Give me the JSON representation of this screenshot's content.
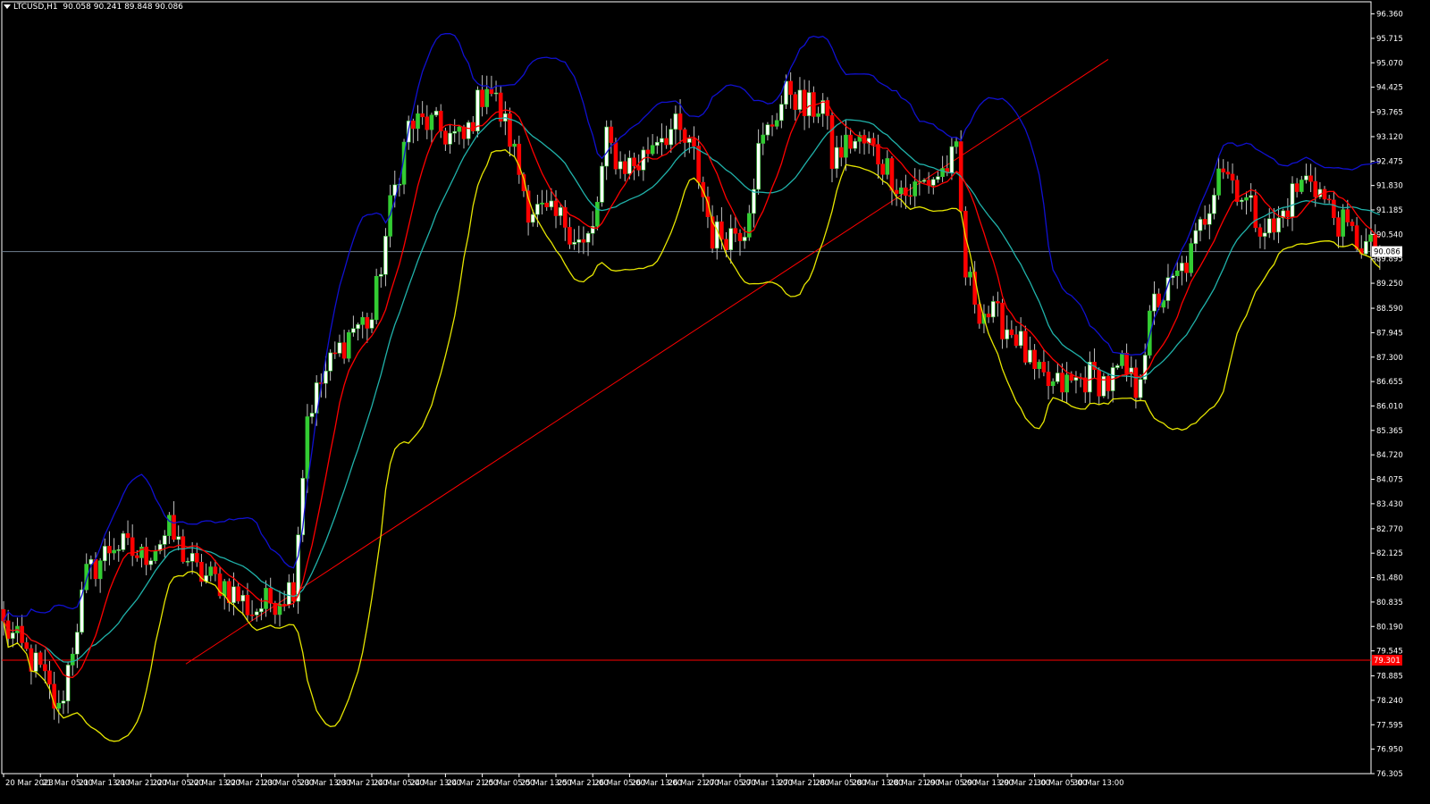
{
  "header": {
    "symbol": "LTCUSD,H1",
    "ohlc": "90.058 90.241 89.848 90.086"
  },
  "chart_data": {
    "type": "candlestick",
    "title": "LTCUSD,H1",
    "ylim": [
      76.305,
      96.68
    ],
    "y_ticks": [
      "96.360",
      "95.715",
      "95.070",
      "94.425",
      "93.765",
      "93.120",
      "92.475",
      "91.830",
      "91.185",
      "90.540",
      "89.895",
      "89.250",
      "88.590",
      "87.945",
      "87.300",
      "86.655",
      "86.010",
      "85.365",
      "84.720",
      "84.075",
      "83.430",
      "82.770",
      "82.125",
      "81.480",
      "80.835",
      "80.190",
      "79.545",
      "78.885",
      "78.240",
      "77.595",
      "76.950",
      "76.305"
    ],
    "x_ticks": [
      "20 Mar 2023",
      "21 Mar 05:00",
      "21 Mar 13:00",
      "21 Mar 21:00",
      "22 Mar 05:00",
      "22 Mar 13:00",
      "22 Mar 21:00",
      "23 Mar 05:00",
      "23 Mar 13:00",
      "23 Mar 21:00",
      "24 Mar 05:00",
      "24 Mar 13:00",
      "24 Mar 21:00",
      "25 Mar 05:00",
      "25 Mar 13:00",
      "25 Mar 21:00",
      "26 Mar 05:00",
      "26 Mar 13:00",
      "26 Mar 21:00",
      "27 Mar 05:00",
      "27 Mar 13:00",
      "27 Mar 21:00",
      "28 Mar 05:00",
      "28 Mar 13:00",
      "28 Mar 21:00",
      "29 Mar 05:00",
      "29 Mar 13:00",
      "29 Mar 21:00",
      "30 Mar 05:00",
      "30 Mar 13:00"
    ],
    "bars_per_tick": 8,
    "current_price": 90.086,
    "current_price_label": "90.086",
    "support_level": 79.3,
    "support_label": "79.301",
    "trendline": {
      "start": [
        "22 Mar 13:00",
        79.2
      ],
      "end": [
        "30 Mar 21:00",
        95.16
      ]
    },
    "close_anchors": [
      [
        0,
        80.2
      ],
      [
        8,
        79.0
      ],
      [
        12,
        77.9
      ],
      [
        18,
        81.5
      ],
      [
        24,
        82.4
      ],
      [
        30,
        82.0
      ],
      [
        36,
        82.7
      ],
      [
        42,
        81.6
      ],
      [
        48,
        81.3
      ],
      [
        54,
        80.6
      ],
      [
        60,
        81.0
      ],
      [
        63,
        81.3
      ],
      [
        66,
        85.8
      ],
      [
        70,
        86.9
      ],
      [
        76,
        88.1
      ],
      [
        80,
        88.3
      ],
      [
        84,
        91.2
      ],
      [
        88,
        93.4
      ],
      [
        92,
        93.5
      ],
      [
        96,
        93.2
      ],
      [
        100,
        93.0
      ],
      [
        105,
        94.6
      ],
      [
        110,
        93.1
      ],
      [
        114,
        91.3
      ],
      [
        118,
        91.0
      ],
      [
        122,
        90.9
      ],
      [
        126,
        90.2
      ],
      [
        128,
        90.6
      ],
      [
        131,
        93.0
      ],
      [
        134,
        92.4
      ],
      [
        138,
        92.4
      ],
      [
        142,
        93.2
      ],
      [
        146,
        93.3
      ],
      [
        150,
        92.6
      ],
      [
        154,
        90.5
      ],
      [
        158,
        90.6
      ],
      [
        161,
        90.8
      ],
      [
        164,
        92.7
      ],
      [
        168,
        93.8
      ],
      [
        171,
        94.4
      ],
      [
        174,
        93.8
      ],
      [
        178,
        94.0
      ],
      [
        180,
        92.5
      ],
      [
        184,
        93.0
      ],
      [
        188,
        92.9
      ],
      [
        192,
        92.3
      ],
      [
        196,
        91.6
      ],
      [
        200,
        91.9
      ],
      [
        204,
        92.2
      ],
      [
        207,
        92.6
      ],
      [
        209,
        89.5
      ],
      [
        212,
        88.6
      ],
      [
        216,
        88.3
      ],
      [
        220,
        87.9
      ],
      [
        224,
        86.8
      ],
      [
        228,
        86.5
      ],
      [
        232,
        86.6
      ],
      [
        236,
        86.8
      ],
      [
        240,
        86.6
      ],
      [
        243,
        87.0
      ],
      [
        246,
        86.5
      ],
      [
        250,
        88.7
      ],
      [
        254,
        89.2
      ],
      [
        258,
        90.0
      ],
      [
        262,
        91.4
      ],
      [
        264,
        92.5
      ],
      [
        268,
        91.8
      ],
      [
        272,
        91.0
      ],
      [
        276,
        90.6
      ],
      [
        280,
        91.6
      ],
      [
        284,
        92.1
      ],
      [
        288,
        91.2
      ],
      [
        292,
        90.6
      ],
      [
        296,
        90.2
      ],
      [
        298,
        90.086
      ]
    ],
    "series": [
      {
        "name": "",
        "color": "#ff0000",
        "kind": "moving-average",
        "period": 10
      },
      {
        "name": "",
        "color": "#20b2aa",
        "kind": "moving-average",
        "period": 20
      },
      {
        "name": "",
        "color": "#1010d0",
        "kind": "bollinger-upper",
        "period": 20
      },
      {
        "name": "",
        "color": "#e6e600",
        "kind": "bollinger-lower",
        "period": 20
      }
    ],
    "colors": {
      "bull_body": "#ffffff",
      "bull_alt": "#33cc33",
      "bear_body": "#ff0000",
      "wick": "#c0c0c0",
      "grid_axis": "#ffffff",
      "price_line": "#708090"
    }
  }
}
